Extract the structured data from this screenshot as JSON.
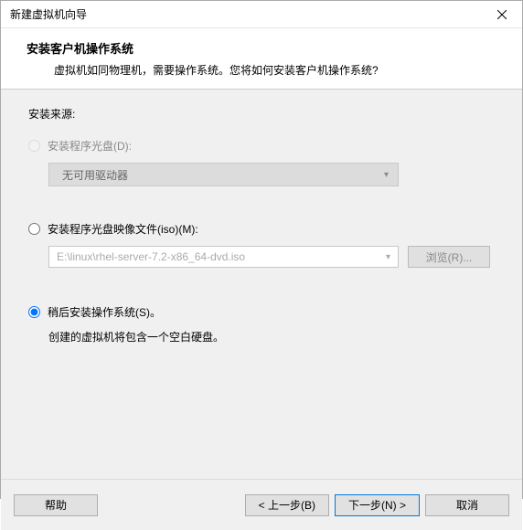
{
  "window": {
    "title": "新建虚拟机向导"
  },
  "header": {
    "title": "安装客户机操作系统",
    "description": "虚拟机如同物理机，需要操作系统。您将如何安装客户机操作系统?"
  },
  "content": {
    "source_label": "安装来源:",
    "option1": {
      "label": "安装程序光盘(D):",
      "dropdown_text": "无可用驱动器"
    },
    "option2": {
      "label": "安装程序光盘映像文件(iso)(M):",
      "file_path": "E:\\linux\\rhel-server-7.2-x86_64-dvd.iso",
      "browse_label": "浏览(R)..."
    },
    "option3": {
      "label": "稍后安装操作系统(S)。",
      "description": "创建的虚拟机将包含一个空白硬盘。",
      "selected": true
    }
  },
  "footer": {
    "help": "帮助",
    "back": "< 上一步(B)",
    "next": "下一步(N) >",
    "cancel": "取消"
  }
}
